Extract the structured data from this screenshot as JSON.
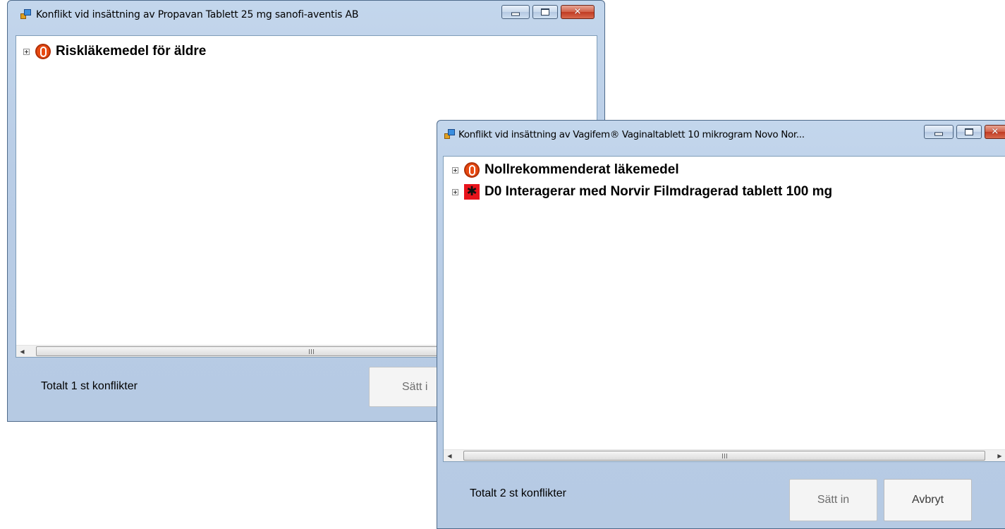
{
  "window1": {
    "title": "Konflikt vid insättning av Propavan Tablett 25 mg sanofi-aventis AB",
    "tree_items": [
      {
        "label": "Riskläkemedel för äldre",
        "icon": "zero-recommendation-icon"
      }
    ],
    "scroll_grip": "|||",
    "status_text": "Totalt 1 st konflikter",
    "insert_button": "Sätt i"
  },
  "window2": {
    "title": "Konflikt vid insättning av Vagifem® Vaginaltablett 10 mikrogram Novo Nor...",
    "tree_items": [
      {
        "label": "Nollrekommenderat läkemedel",
        "icon": "zero-recommendation-icon"
      },
      {
        "label": "D0 Interagerar med Norvir Filmdragerad tablett 100 mg",
        "icon": "interaction-warning-icon"
      }
    ],
    "scroll_grip": "|||",
    "status_text": "Totalt 2 st konflikter",
    "insert_button": "Sätt in",
    "cancel_button": "Avbryt"
  },
  "caption_buttons": {
    "minimize_icon": "minimize-icon",
    "maximize_icon": "maximize-icon",
    "close_icon": "close-icon",
    "close_glyph": "✕"
  },
  "colors": {
    "window_frame": "#b9cde6",
    "close_button": "#c03a22",
    "zero_icon": "#e84a12",
    "interaction_icon": "#e8141c"
  }
}
